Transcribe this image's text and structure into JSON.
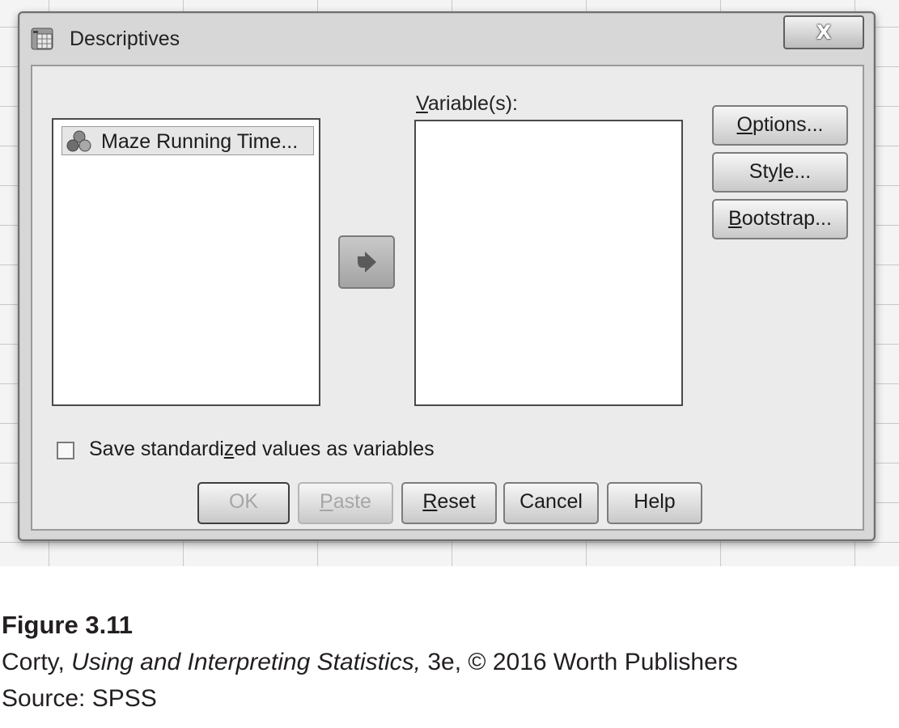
{
  "dialog": {
    "title": "Descriptives",
    "close_glyph": "X",
    "app_icon": "descriptives-dialog-icon"
  },
  "source_list": {
    "items": [
      {
        "label": "Maze Running Time...",
        "icon": "scale-variable-icon"
      }
    ]
  },
  "target_list": {
    "label_underlined": "V",
    "label_rest": "ariable(s):",
    "items": []
  },
  "arrow_button": {
    "icon": "right-arrow-icon"
  },
  "side_buttons": {
    "options": {
      "underlined": "O",
      "rest": "ptions..."
    },
    "style": {
      "before": "Sty",
      "underlined": "l",
      "rest": "e..."
    },
    "bootstrap": {
      "underlined": "B",
      "rest": "ootstrap..."
    }
  },
  "checkbox": {
    "before": "Save standardi",
    "underlined": "z",
    "rest": "ed values as variables",
    "checked": false
  },
  "bottom_buttons": {
    "ok": "OK",
    "paste_underlined": "P",
    "paste_rest": "aste",
    "reset_underlined": "R",
    "reset_rest": "eset",
    "cancel": "Cancel",
    "help": "Help"
  },
  "caption": {
    "figure": "Figure 3.11",
    "credit_author": "Corty, ",
    "credit_title": "Using and Interpreting Statistics,",
    "credit_rest": " 3e, © 2016 Worth Publishers",
    "source": "Source: SPSS"
  },
  "colors": {
    "dialog_frame": "#d7d7d7",
    "content_panel": "#ebebeb",
    "disabled_text": "#a6a6a6"
  }
}
